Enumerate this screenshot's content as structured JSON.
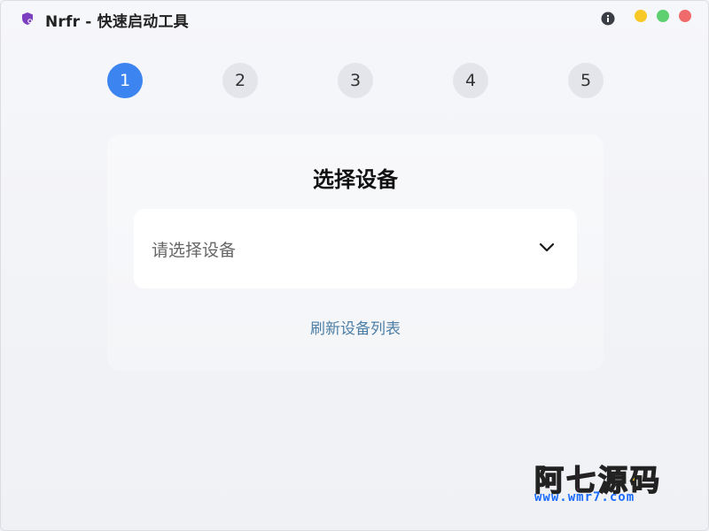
{
  "window": {
    "title": "Nrfr - 快速启动工具"
  },
  "titlebar": {
    "icons": {
      "app": "shield-icon",
      "info": "info-icon"
    },
    "controls": [
      {
        "name": "minimize",
        "color": "#f8c926"
      },
      {
        "name": "maximize",
        "color": "#5fd06f"
      },
      {
        "name": "close",
        "color": "#ef6b6b"
      }
    ]
  },
  "steps": {
    "active": 1,
    "items": [
      "1",
      "2",
      "3",
      "4",
      "5"
    ],
    "active_color": "#3c84f0",
    "inactive_color": "#e4e5ea"
  },
  "device_card": {
    "title": "选择设备",
    "select": {
      "placeholder": "请选择设备",
      "icon": "chevron-down-icon"
    },
    "refresh_label": "刷新设备列表",
    "link_color": "#4d7fa6"
  },
  "watermark": {
    "logo": "阿七源码",
    "url": "www.wmr7.com"
  }
}
